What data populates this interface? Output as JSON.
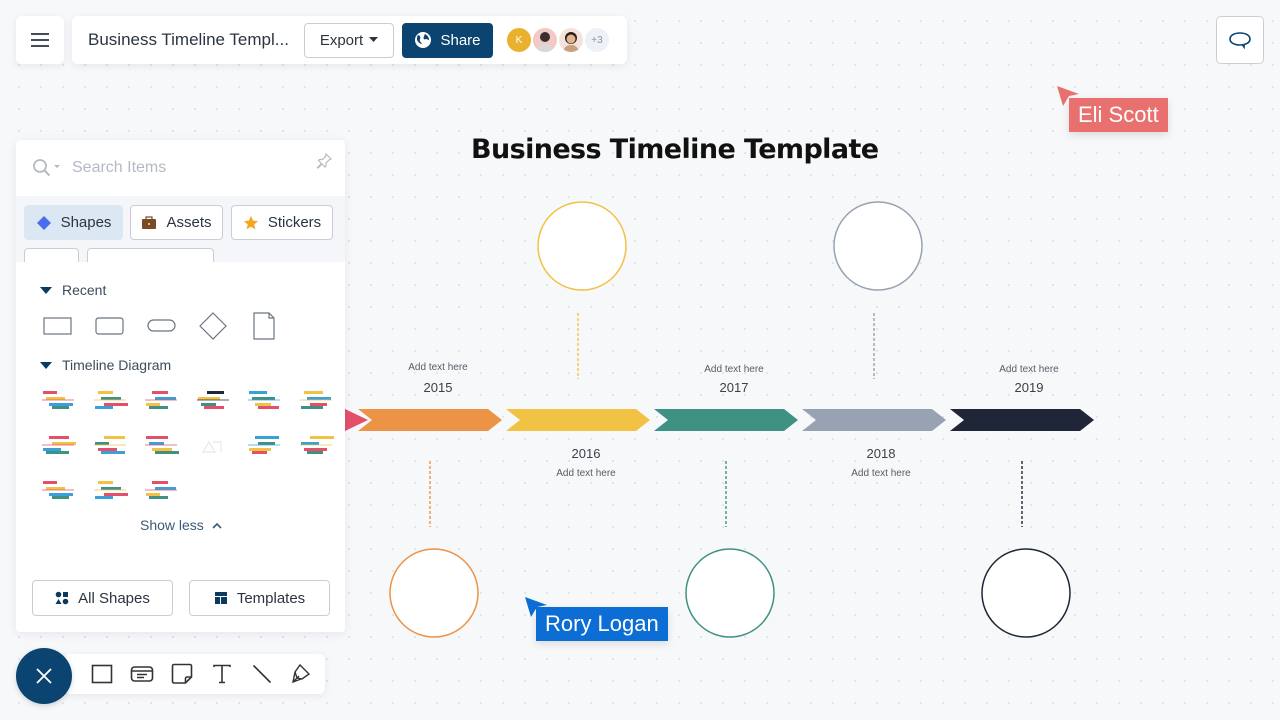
{
  "app": {
    "doc_title": "Business Timeline Templ...",
    "export_label": "Export",
    "share_label": "Share",
    "collaborators": [
      {
        "initial": "K",
        "color": "#e9b12e"
      },
      {
        "initial": "",
        "color": "#f2c9c6"
      },
      {
        "initial": "",
        "color": "#f4e3dc"
      }
    ],
    "more_collaborators": "+3"
  },
  "cursors": [
    {
      "name": "Eli Scott",
      "color": "#e8706e"
    },
    {
      "name": "Rory Logan",
      "color": "#0c6ed4"
    }
  ],
  "panel": {
    "search_placeholder": "Search Items",
    "tabs": [
      {
        "label": "Shapes",
        "icon": "diamond-icon",
        "active": true
      },
      {
        "label": "Assets",
        "icon": "briefcase-icon",
        "active": false
      },
      {
        "label": "Stickers",
        "icon": "star-icon",
        "active": false
      }
    ],
    "sections": {
      "recent": "Recent",
      "timeline": "Timeline Diagram"
    },
    "recent_shapes": [
      "rectangle",
      "rounded-rectangle",
      "pill",
      "diamond",
      "document"
    ],
    "timeline_thumbnails": 15,
    "show_less": "Show less",
    "all_shapes": "All Shapes",
    "templates": "Templates"
  },
  "toolbar": {
    "tools": [
      "rectangle",
      "card",
      "sticky-note",
      "text",
      "line",
      "pen"
    ]
  },
  "diagram": {
    "title": "Business Timeline Template",
    "milestones": [
      {
        "year": "2015",
        "text": "Add text here",
        "position": "above",
        "color": "#ec9346",
        "circle": "below"
      },
      {
        "year": "2016",
        "text": "Add text here",
        "position": "below",
        "color": "#f2c244",
        "circle": "above"
      },
      {
        "year": "2017",
        "text": "Add text here",
        "position": "above",
        "color": "#3f9183",
        "circle": "below"
      },
      {
        "year": "2018",
        "text": "Add text here",
        "position": "below",
        "color": "#98a2b3",
        "circle": "above"
      },
      {
        "year": "2019",
        "text": "Add text here",
        "position": "above",
        "color": "#1f2638",
        "circle": "below"
      }
    ],
    "start_color": "#e4506a"
  }
}
